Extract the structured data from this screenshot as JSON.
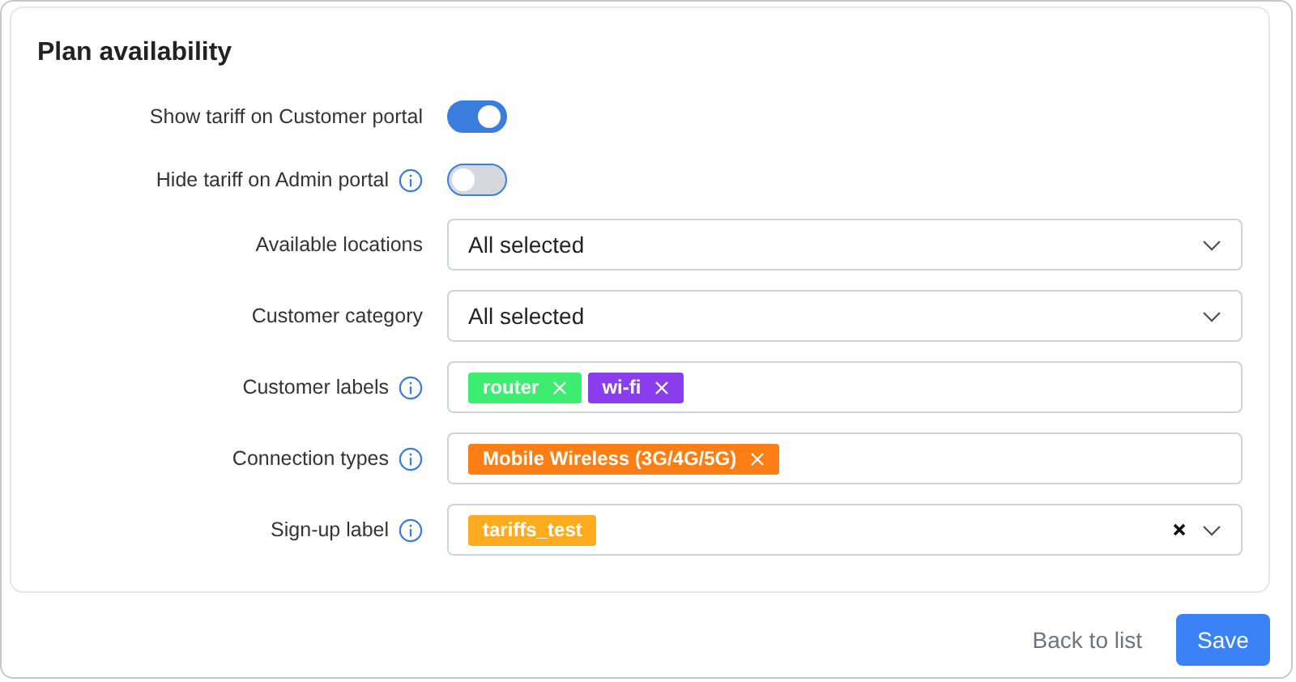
{
  "section": {
    "title": "Plan availability"
  },
  "fields": [
    {
      "kind": "toggle",
      "label": "Show tariff on Customer portal",
      "info": false,
      "on": true
    },
    {
      "kind": "toggle",
      "label": "Hide tariff on Admin portal",
      "info": true,
      "on": false
    },
    {
      "kind": "select",
      "label": "Available locations",
      "info": false,
      "value": "All selected"
    },
    {
      "kind": "select",
      "label": "Customer category",
      "info": false,
      "value": "All selected"
    },
    {
      "kind": "tags",
      "label": "Customer labels",
      "info": true,
      "tags": [
        {
          "text": "router",
          "color": "#3ded6f",
          "removable": true
        },
        {
          "text": "wi-fi",
          "color": "#8a3ded",
          "removable": true
        }
      ]
    },
    {
      "kind": "tags",
      "label": "Connection types",
      "info": true,
      "tags": [
        {
          "text": "Mobile Wireless (3G/4G/5G)",
          "color": "#fd7e14",
          "removable": true
        }
      ]
    },
    {
      "kind": "tagselect",
      "label": "Sign-up label",
      "info": true,
      "clearable": true,
      "tags": [
        {
          "text": "tariffs_test",
          "color": "#fdab1f",
          "removable": false
        }
      ]
    }
  ],
  "buttons": [
    {
      "kind": "link",
      "label": "Back to list"
    },
    {
      "kind": "primary",
      "label": "Save"
    }
  ]
}
